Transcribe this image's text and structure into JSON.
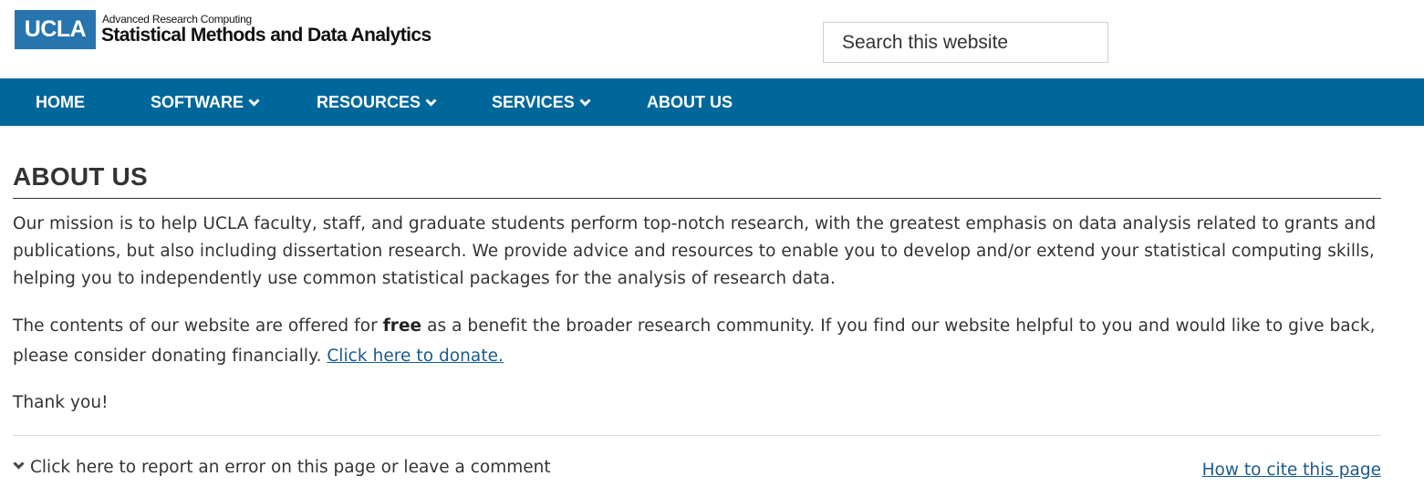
{
  "header": {
    "logo_text": "UCLA",
    "org_subtitle": "Advanced Research Computing",
    "org_title": "Statistical Methods and Data Analytics",
    "search_placeholder": "Search this website",
    "brand_color": "#2774ae"
  },
  "nav": {
    "background_color": "#00679b",
    "items": [
      {
        "label": "HOME",
        "has_dropdown": false
      },
      {
        "label": "SOFTWARE",
        "has_dropdown": true
      },
      {
        "label": "RESOURCES",
        "has_dropdown": true
      },
      {
        "label": "SERVICES",
        "has_dropdown": true
      },
      {
        "label": "ABOUT US",
        "has_dropdown": false
      }
    ]
  },
  "main": {
    "title": "ABOUT US",
    "paragraph1": "Our mission is to help UCLA faculty, staff, and graduate students perform top-notch research, with the greatest emphasis on data analysis related to grants and publications, but also including dissertation research. We provide advice and resources to enable you to develop and/or extend your statistical computing skills, helping you to independently use common statistical packages for the analysis of research data.",
    "paragraph2_before": "The contents of our website are offered for ",
    "paragraph2_bold": "free",
    "paragraph2_after": " as a benefit the broader research community. If you find our website helpful to you and would like to give back, please consider donating financially. ",
    "donate_link": "Click here to donate.",
    "paragraph3": "Thank you!"
  },
  "footer": {
    "report_text": "Click here to report an error on this page or leave a comment",
    "cite_link": "How to cite this page",
    "link_color": "#1a5a8c"
  }
}
